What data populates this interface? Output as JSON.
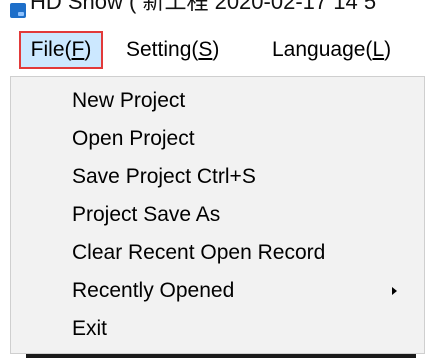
{
  "window": {
    "title": "HD Show ( 新工程 2020-02-17 14 5"
  },
  "menubar": {
    "file": {
      "text": "File(",
      "mnemonic": "F",
      "close": ")"
    },
    "setting": {
      "text": "Setting(",
      "mnemonic": "S",
      "close": ")"
    },
    "language": {
      "text": "Language(",
      "mnemonic": "L",
      "close": ")"
    }
  },
  "file_menu": {
    "items": [
      {
        "label": "New Project"
      },
      {
        "label": "Open Project"
      },
      {
        "label": "Save Project  Ctrl+S"
      },
      {
        "label": "Project Save As"
      },
      {
        "label": "Clear Recent Open Record"
      },
      {
        "label": "Recently Opened",
        "submenu": true
      },
      {
        "label": "Exit"
      }
    ]
  },
  "colors": {
    "active_menu_bg": "#cce8ff",
    "highlight_border": "#e23a3a",
    "dropdown_bg": "#f2f2f2"
  }
}
